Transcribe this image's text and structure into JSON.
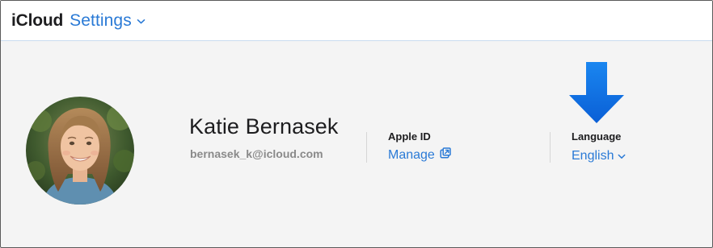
{
  "header": {
    "brand": "iCloud",
    "app_name": "Settings"
  },
  "account": {
    "name": "Katie Bernasek",
    "email": "bernasek_k@icloud.com",
    "apple_id": {
      "label": "Apple ID",
      "link": "Manage"
    },
    "language": {
      "label": "Language",
      "value": "English"
    }
  },
  "icons": {
    "header_chevron": "chevron-down-icon",
    "external_link": "external-link-icon",
    "language_chevron": "chevron-down-icon",
    "callout": "arrow-down-icon"
  },
  "colors": {
    "accent": "#2a7ad6",
    "arrow": "#1570e6",
    "text": "#1d1d1f",
    "muted": "#8a8a8a",
    "panel": "#f4f4f4"
  }
}
